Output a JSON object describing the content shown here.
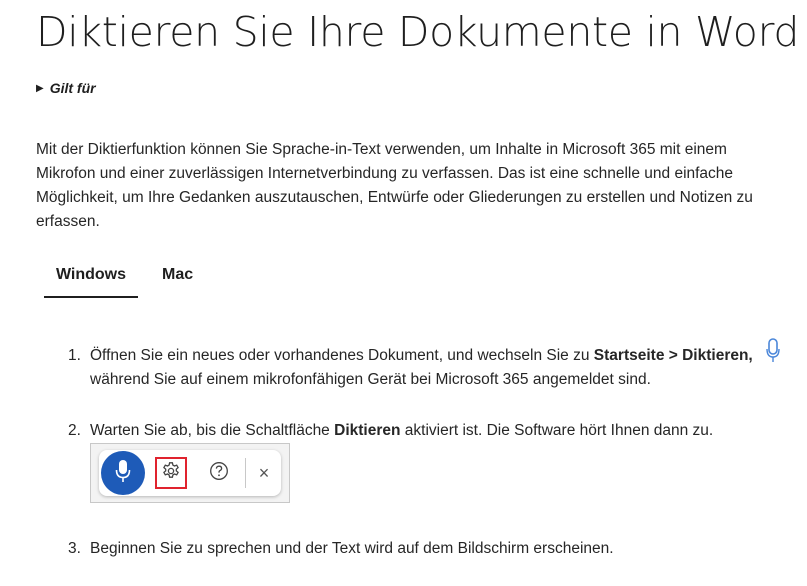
{
  "title": "Diktieren Sie Ihre Dokumente in Word",
  "applies_to": {
    "label": "Gilt für",
    "toggle_glyph": "▶"
  },
  "intro": "Mit der Diktierfunktion können Sie Sprache-in-Text verwenden, um Inhalte in Microsoft 365 mit einem Mikrofon und einer zuverlässigen Internetverbindung zu verfassen. Das ist eine schnelle und einfache Möglichkeit, um Ihre Gedanken auszutauschen, Entwürfe oder Gliederungen zu erstellen und Notizen zu erfassen.",
  "tabs": [
    {
      "label": "Windows",
      "active": true
    },
    {
      "label": "Mac",
      "active": false
    }
  ],
  "steps": [
    {
      "num": "1.",
      "parts": [
        {
          "t": "Öffnen Sie ein neues oder vorhandenes Dokument, und wechseln Sie zu ",
          "b": false
        },
        {
          "t": "Startseite > Diktieren,",
          "b": true
        },
        {
          "t": " während Sie auf einem mikrofonfähigen Gerät bei Microsoft 365 angemeldet sind.",
          "b": false
        }
      ]
    },
    {
      "num": "2.",
      "parts": [
        {
          "t": "Warten Sie ab, bis die Schaltfläche ",
          "b": false
        },
        {
          "t": "Diktieren",
          "b": true
        },
        {
          "t": " aktiviert ist. Die Software hört Ihnen dann zu.",
          "b": false
        }
      ]
    },
    {
      "num": "3.",
      "parts": [
        {
          "t": "Beginnen Sie zu sprechen und der Text wird auf dem Bildschirm erscheinen.",
          "b": false
        }
      ]
    }
  ],
  "dictation_toolbar": {
    "buttons": [
      "microphone-icon",
      "gear-icon",
      "help-icon",
      "close-icon"
    ],
    "close_glyph": "×",
    "mic_color": "#1e5bb8",
    "highlight_color": "#e0232e"
  },
  "side_icon": "microphone-icon"
}
